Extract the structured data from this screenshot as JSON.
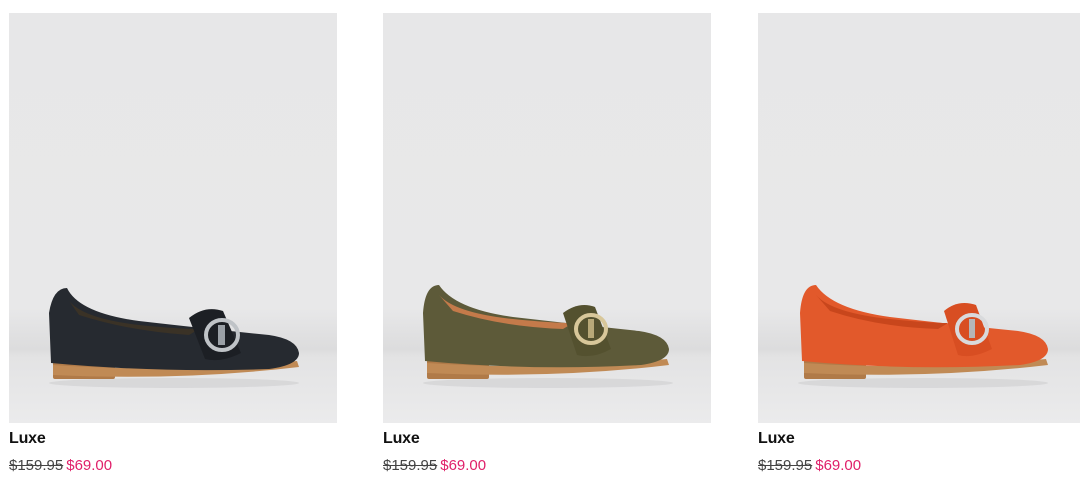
{
  "products": [
    {
      "name": "Luxe",
      "original_price": "$159.95",
      "sale_price": "$69.00",
      "color": "#262a30",
      "icon": "black-buckle-loafer"
    },
    {
      "name": "Luxe",
      "original_price": "$159.95",
      "sale_price": "$69.00",
      "color": "#5d5a39",
      "icon": "olive-buckle-loafer"
    },
    {
      "name": "Luxe",
      "original_price": "$159.95",
      "sale_price": "$69.00",
      "color": "#e2592b",
      "icon": "orange-buckle-loafer"
    }
  ],
  "colors": {
    "sale_price": "#e0206a",
    "image_background": "#e8e8e9",
    "heel": "#b07a48"
  }
}
